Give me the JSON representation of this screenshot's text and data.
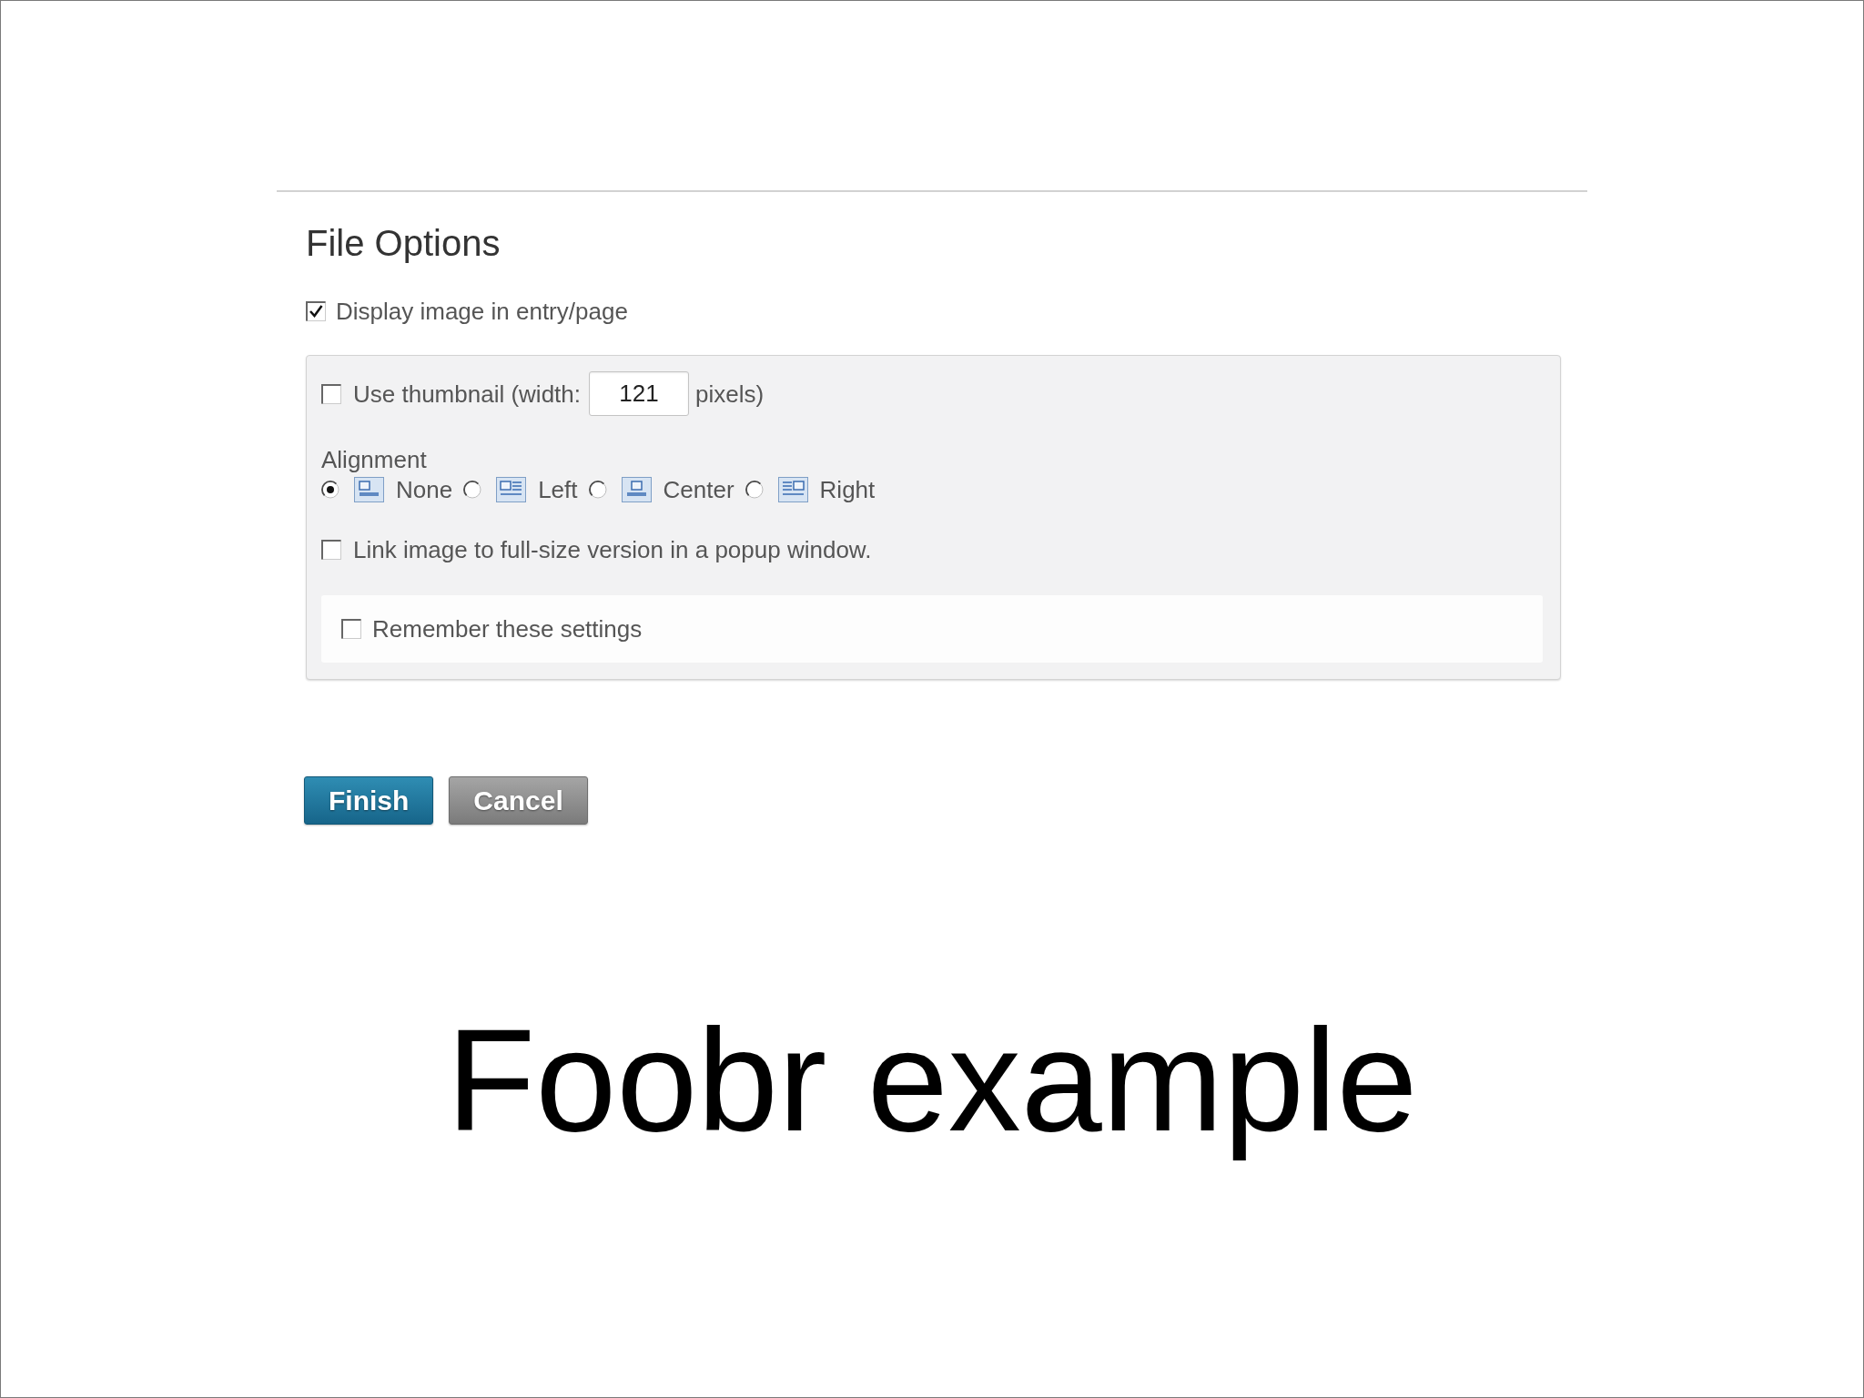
{
  "section": {
    "title": "File Options"
  },
  "display_image": {
    "label": "Display image in entry/page",
    "checked": true
  },
  "options_panel": {
    "thumbnail": {
      "label": "Use thumbnail (width:",
      "checked": false,
      "value": "121",
      "suffix": "pixels)"
    },
    "alignment": {
      "label": "Alignment",
      "options": [
        {
          "kind": "none",
          "label": "None",
          "selected": true
        },
        {
          "kind": "left",
          "label": "Left",
          "selected": false
        },
        {
          "kind": "center",
          "label": "Center",
          "selected": false
        },
        {
          "kind": "right",
          "label": "Right",
          "selected": false
        }
      ]
    },
    "link_popup": {
      "label": "Link image to full-size version in a popup window.",
      "checked": false
    },
    "remember": {
      "label": "Remember these settings",
      "checked": false
    }
  },
  "buttons": [
    {
      "kind": "primary",
      "label": "Finish"
    },
    {
      "kind": "secondary",
      "label": "Cancel"
    }
  ],
  "caption": "Foobr example"
}
